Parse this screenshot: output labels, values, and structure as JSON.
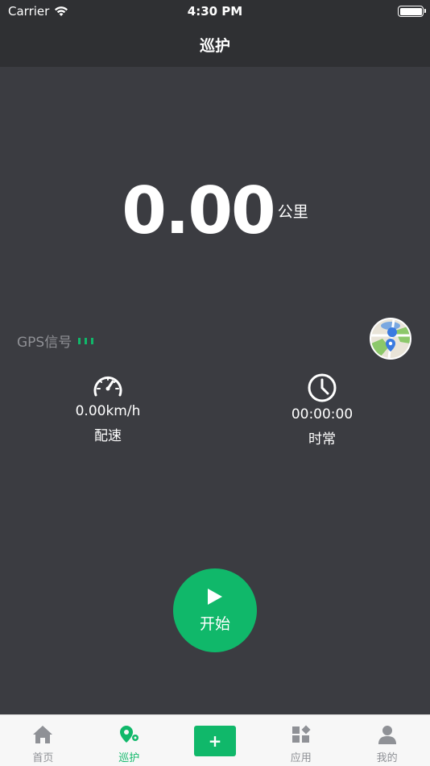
{
  "status_bar": {
    "carrier": "Carrier",
    "time": "4:30 PM"
  },
  "navbar": {
    "title": "巡护"
  },
  "distance": {
    "value": "0.00",
    "unit": "公里"
  },
  "gps": {
    "label": "GPS信号",
    "signal_bars": 3
  },
  "stats": {
    "speed": {
      "value": "0.00km/h",
      "label": "配速"
    },
    "duration": {
      "value": "00:00:00",
      "label": "时常"
    }
  },
  "start_button": {
    "label": "开始"
  },
  "tabbar": {
    "home": "首页",
    "patrol": "巡护",
    "add": "+",
    "apps": "应用",
    "mine": "我的"
  },
  "colors": {
    "accent": "#10b86a",
    "background": "#3b3c41",
    "bar": "#2f3033"
  }
}
